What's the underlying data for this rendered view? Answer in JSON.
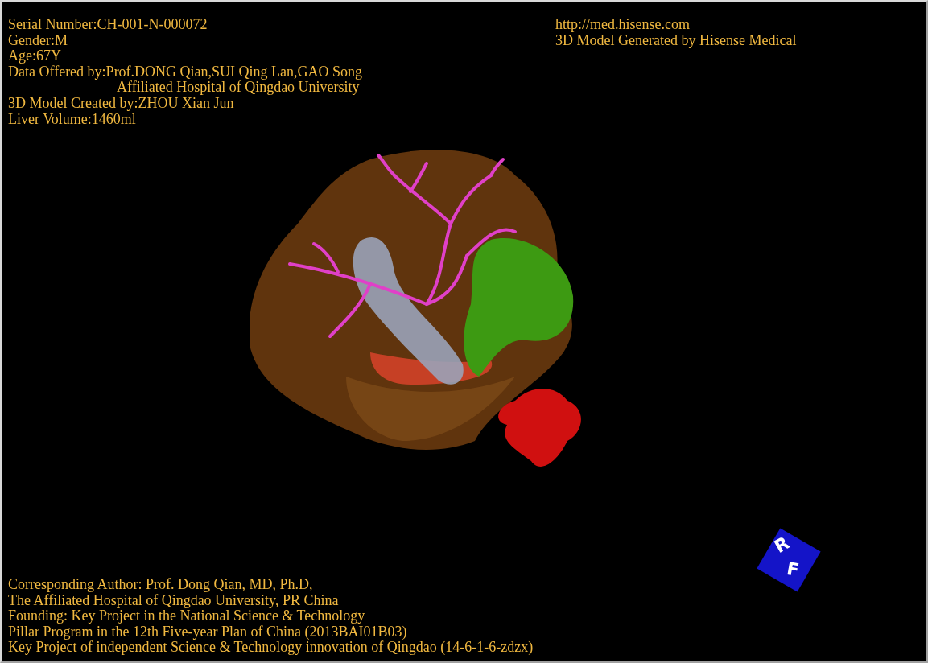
{
  "info": [
    {
      "kind": "line",
      "text": "Serial Number:CH-001-N-000072"
    },
    {
      "kind": "line",
      "text": "Gender:M"
    },
    {
      "kind": "line",
      "text": "Age:67Y"
    },
    {
      "kind": "line",
      "text": "Data Offered by:Prof.DONG Qian,SUI Qing Lan,GAO Song"
    },
    {
      "kind": "continuation",
      "text": "Affiliated Hospital of Qingdao University"
    },
    {
      "kind": "line",
      "text": "3D Model Created by:ZHOU Xian Jun"
    },
    {
      "kind": "line",
      "text": "Liver Volume:1460ml"
    }
  ],
  "credits": [
    "http://med.hisense.com",
    "3D Model Generated by Hisense Medical"
  ],
  "orientation_cube": {
    "labels": [
      "R",
      "F"
    ]
  },
  "footer": [
    "Corresponding Author: Prof. Dong Qian, MD, Ph.D,",
    "The Affiliated Hospital of Qingdao University, PR China",
    "Founding: Key Project in the National Science & Technology",
    "Pillar Program in the 12th Five-year Plan of China (2013BAI01B03)",
    "Key Project of independent Science & Technology innovation of Qingdao (14-6-1-6-zdzx)"
  ]
}
